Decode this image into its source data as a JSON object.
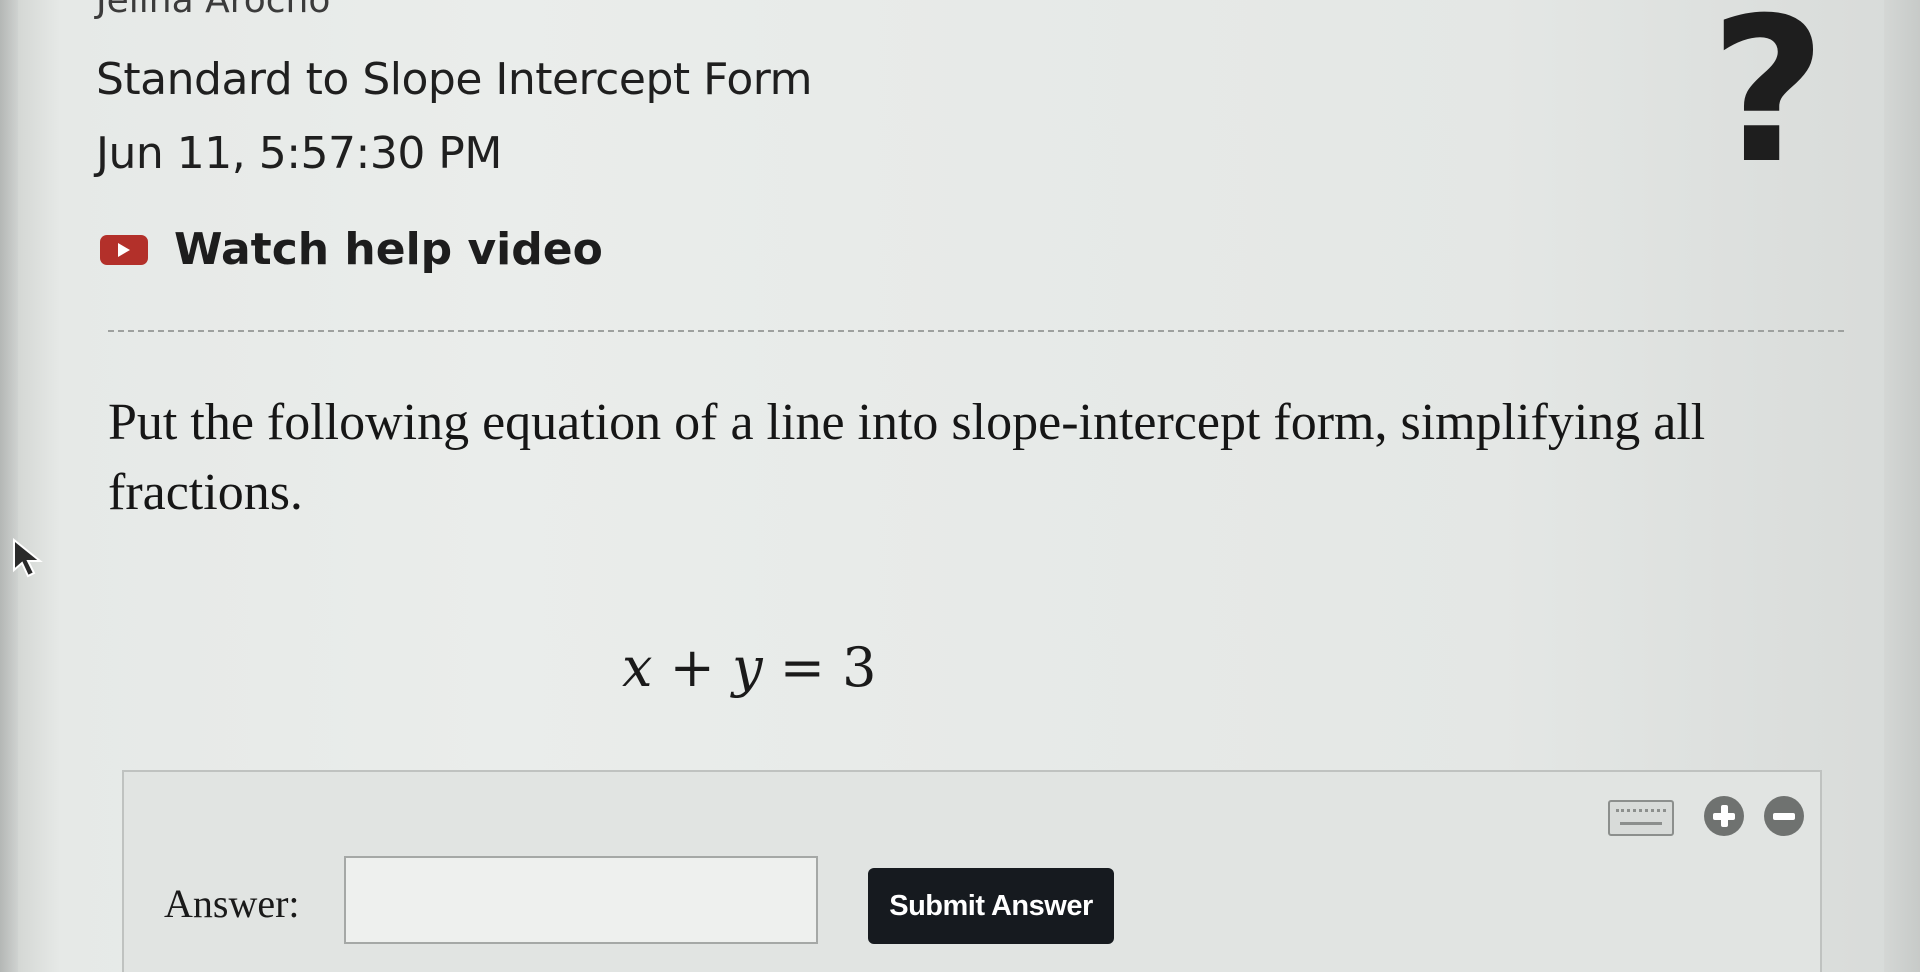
{
  "header": {
    "student_name": "Jelina Arocho",
    "assignment_title": "Standard to Slope Intercept Form",
    "timestamp": "Jun 11, 5:57:30 PM"
  },
  "help": {
    "label": "Watch help video",
    "icon": "play-video-icon"
  },
  "help_button": {
    "glyph": "?"
  },
  "question": {
    "prompt": "Put the following equation of a line into slope-intercept form, simplifying all fractions.",
    "equation": {
      "lhs_a": "x",
      "op": "+",
      "lhs_b": "y",
      "eq": "=",
      "rhs": "3"
    }
  },
  "answer": {
    "label": "Answer:",
    "value": "",
    "placeholder": "",
    "submit_label": "Submit Answer",
    "tools": [
      "keyboard-icon",
      "zoom-in-icon",
      "zoom-out-icon"
    ]
  },
  "colors": {
    "accent_red": "#b3302a",
    "button_dark": "#161a1f",
    "text": "#1f1f1f"
  }
}
